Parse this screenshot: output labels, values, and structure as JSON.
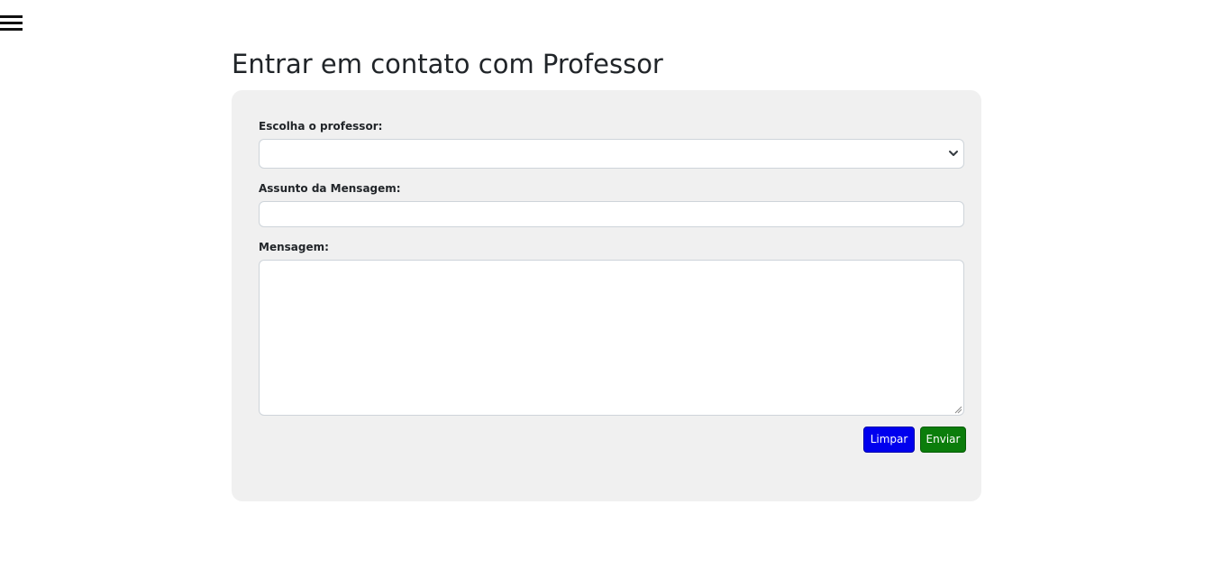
{
  "nav": {
    "menu_icon": "hamburger-menu-icon"
  },
  "page": {
    "title": "Entrar em contato com Professor"
  },
  "form": {
    "teacher_label": "Escolha o professor:",
    "teacher_selected": "",
    "subject_label": "Assunto da Mensagem:",
    "subject_value": "",
    "message_label": "Mensagem:",
    "message_value": "",
    "clear_label": "Limpar",
    "send_label": "Enviar"
  },
  "colors": {
    "card_background": "#f0f0f0",
    "clear_button": "#0000ee",
    "send_button": "#0b7d0b"
  }
}
